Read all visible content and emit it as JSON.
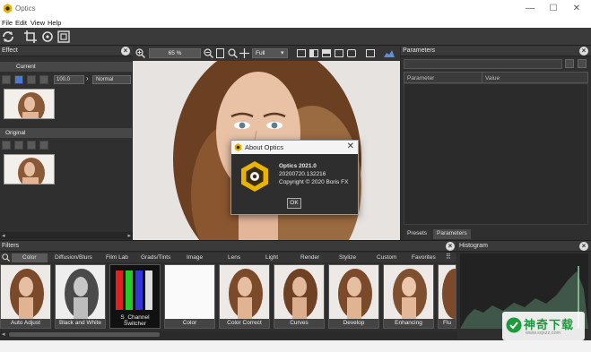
{
  "window": {
    "title": "Optics",
    "min": "—",
    "max": "☐",
    "close": "✕"
  },
  "menu": [
    "File",
    "Edit",
    "View",
    "Help"
  ],
  "effect_panel": {
    "title": "Effect",
    "current_label": "Current",
    "value": "100.0",
    "blend_mode": "Normal",
    "original_label": "Original"
  },
  "viewer": {
    "zoom": "65 %",
    "fit": "Full"
  },
  "about_dialog": {
    "title": "About Optics",
    "version": "Optics 2021.0",
    "build": "20200720.132216",
    "copyright": "Copyright © 2020 Boris FX",
    "ok": "OK"
  },
  "parameters": {
    "title": "Parameters",
    "col_param": "Parameter",
    "col_value": "Value",
    "tab_presets": "Presets",
    "tab_parameters": "Parameters"
  },
  "filters": {
    "title": "Filters",
    "categories": [
      "Color",
      "Diffusion/Blurs",
      "Film Lab",
      "Grads/Tints",
      "Image",
      "Lens",
      "Light",
      "Render",
      "Stylize",
      "Custom",
      "Favorites"
    ],
    "tiles": [
      "Auto Adjust",
      "Black and White",
      "S_Channel Switcher",
      "Color",
      "Color Correct",
      "Curves",
      "Develop",
      "Enhancing",
      "Flu"
    ]
  },
  "histogram": {
    "title": "Histogram"
  },
  "watermark": {
    "brand": "神奇下载",
    "url": "www.sqxzz.com"
  },
  "colors": {
    "accent": "#1b9b3a",
    "panel": "#2f2f2f",
    "logo_gold": "#e8b400"
  }
}
